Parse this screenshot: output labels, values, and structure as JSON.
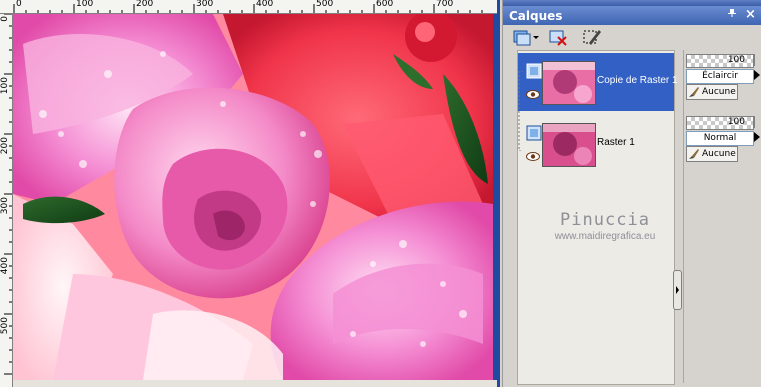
{
  "canvas": {
    "ruler_top_labels": [
      "0",
      "100",
      "200",
      "300",
      "400",
      "500",
      "600",
      "700"
    ],
    "ruler_left_labels": [
      "0",
      "100",
      "200",
      "300",
      "400",
      "500"
    ],
    "colors": {
      "frame": "#1f4aa0",
      "ruler": "#f4f4f0"
    }
  },
  "layers_palette": {
    "title": "Calques",
    "pin_icon": "pin-icon",
    "close_icon": "close-icon",
    "toolbar": {
      "new_layer_icon": "new-raster-layer-icon",
      "delete_icon": "delete-layer-icon",
      "edit_icon": "edit-selection-icon"
    },
    "layers": [
      {
        "name": "Copie de Raster 1",
        "selected": true,
        "opacity": "100",
        "blend_mode": "Éclaircir",
        "mask": "Aucune"
      },
      {
        "name": "Raster 1",
        "selected": false,
        "opacity": "100",
        "blend_mode": "Normal",
        "mask": "Aucune"
      }
    ],
    "selected_color": "#3360c5"
  },
  "watermark": {
    "name": "Pinuccia",
    "url": "www.maidiregrafica.eu"
  }
}
